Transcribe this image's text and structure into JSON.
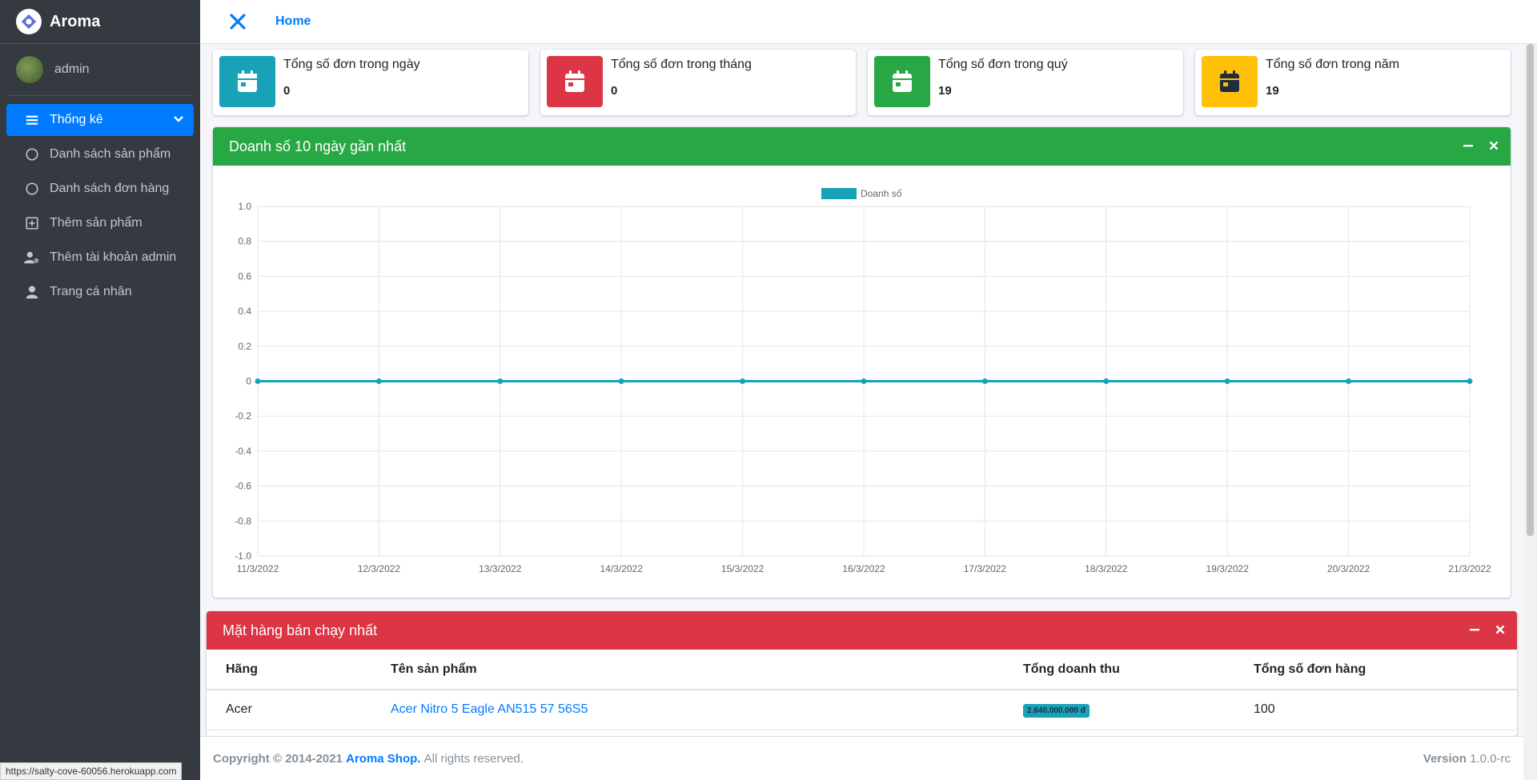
{
  "brand": {
    "name": "Aroma"
  },
  "user": {
    "name": "admin"
  },
  "sidebar": {
    "items": [
      {
        "label": "Thống kê"
      },
      {
        "label": "Danh sách sản phẩm"
      },
      {
        "label": "Danh sách đơn hàng"
      },
      {
        "label": "Thêm sản phẩm"
      },
      {
        "label": "Thêm tài khoản admin"
      },
      {
        "label": "Trang cá nhân"
      }
    ]
  },
  "topbar": {
    "home": "Home"
  },
  "info_boxes": [
    {
      "label": "Tổng số đơn trong ngày",
      "value": "0",
      "color": "#17a2b8",
      "icon": "calendar-icon"
    },
    {
      "label": "Tổng số đơn trong tháng",
      "value": "0",
      "color": "#dc3545",
      "icon": "calendar-icon"
    },
    {
      "label": "Tổng số đơn trong quý",
      "value": "19",
      "color": "#28a745",
      "icon": "calendar-icon"
    },
    {
      "label": "Tổng số đơn trong năm",
      "value": "19",
      "color": "#ffc107",
      "icon": "calendar-icon"
    }
  ],
  "sales_card": {
    "title": "Doanh số 10 ngày gần nhất",
    "color": "#28a745"
  },
  "chart_data": {
    "type": "line",
    "categories": [
      "11/3/2022",
      "12/3/2022",
      "13/3/2022",
      "14/3/2022",
      "15/3/2022",
      "16/3/2022",
      "17/3/2022",
      "18/3/2022",
      "19/3/2022",
      "20/3/2022",
      "21/3/2022"
    ],
    "series": [
      {
        "name": "Doanh số",
        "values": [
          0,
          0,
          0,
          0,
          0,
          0,
          0,
          0,
          0,
          0,
          0
        ],
        "color": "#17a2b8"
      }
    ],
    "yticks": [
      "1.0",
      "0.8",
      "0.6",
      "0.4",
      "0.2",
      "0",
      "-0.2",
      "-0.4",
      "-0.6",
      "-0.8",
      "-1.0"
    ],
    "ylim": [
      -1,
      1
    ],
    "grid": true,
    "legend": "top-center"
  },
  "best_seller_card": {
    "title": "Mặt hàng bán chạy nhất",
    "color": "#dc3545"
  },
  "best_seller_table": {
    "headers": [
      "Hãng",
      "Tên sản phẩm",
      "Tổng doanh thu",
      "Tổng số đơn hàng"
    ],
    "rows": [
      {
        "brand": "Acer",
        "product": "Acer Nitro 5 Eagle AN515 57 56S5",
        "revenue": "2.640.000.000 đ",
        "orders": "100"
      }
    ]
  },
  "footer": {
    "copyright": "Copyright © 2014-2021",
    "shop": "Aroma Shop.",
    "rights": "All rights reserved.",
    "version_label": "Version",
    "version_value": "1.0.0-rc"
  },
  "status_url": "https://salty-cove-60056.herokuapp.com"
}
